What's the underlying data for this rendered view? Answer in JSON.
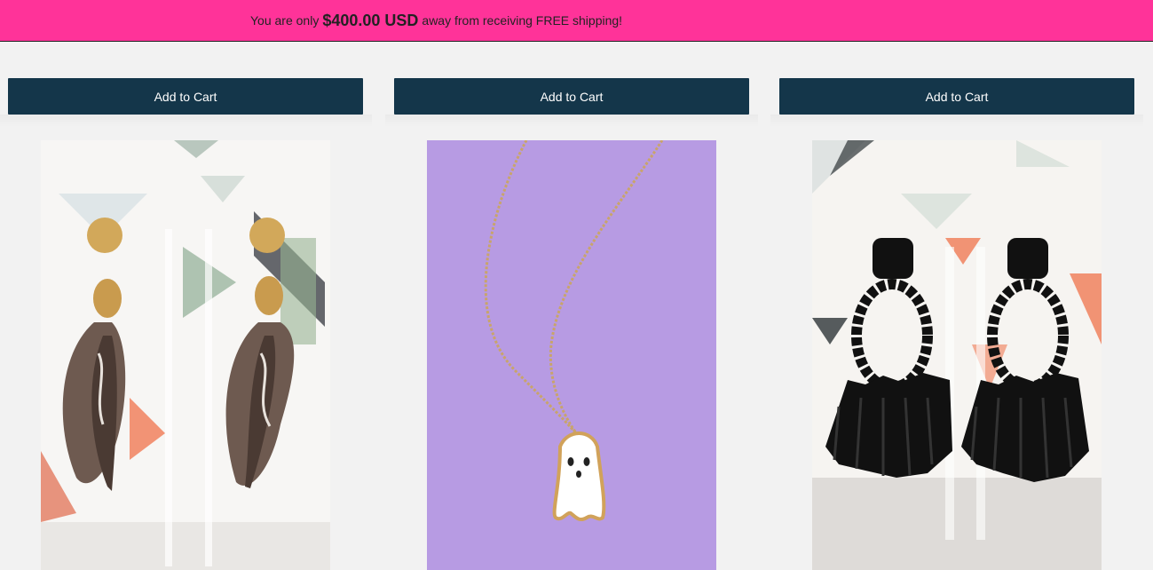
{
  "promo": {
    "prefix": "You are only",
    "amount": "$400.00 USD",
    "suffix": "away from receiving FREE shipping!"
  },
  "colors": {
    "promo_bg": "#ff3399",
    "button_bg": "#14364a",
    "page_bg": "#f2f2f2"
  },
  "products": [
    {
      "button_label": "Add to Cart",
      "image": "gold-feather-earrings-image"
    },
    {
      "button_label": "Add to Cart",
      "image": "ghost-pendant-necklace-image"
    },
    {
      "button_label": "Add to Cart",
      "image": "black-tassel-earrings-image"
    }
  ]
}
